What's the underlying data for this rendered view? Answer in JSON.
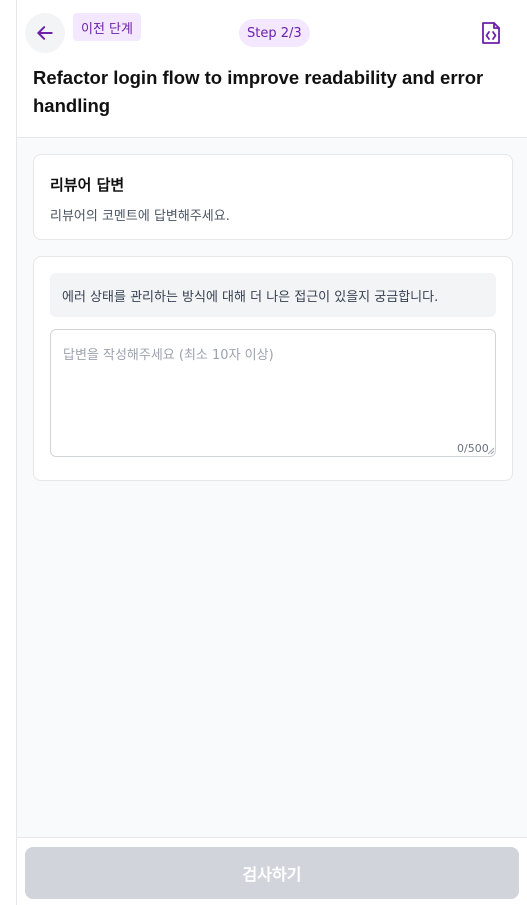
{
  "header": {
    "back_icon": "arrow-left-icon",
    "prev_step_label": "이전 단계",
    "step_label": "Step 2/3",
    "code_icon": "file-code-icon",
    "title": "Refactor login flow to improve readability and error handling"
  },
  "reviewer_card": {
    "title": "리뷰어 답변",
    "description": "리뷰어의 코멘트에 답변해주세요."
  },
  "reply_card": {
    "comment": "에러 상태를 관리하는 방식에 대해 더 나은 접근이 있을지 궁금합니다.",
    "input_value": "",
    "input_placeholder": "답변을 작성해주세요 (최소 10자 이상)",
    "counter": "0/500"
  },
  "footer": {
    "submit_label": "검사하기"
  },
  "colors": {
    "accent": "#6b21a8",
    "badge_bg": "#f3e8ff",
    "button_disabled": "#d1d5db"
  }
}
